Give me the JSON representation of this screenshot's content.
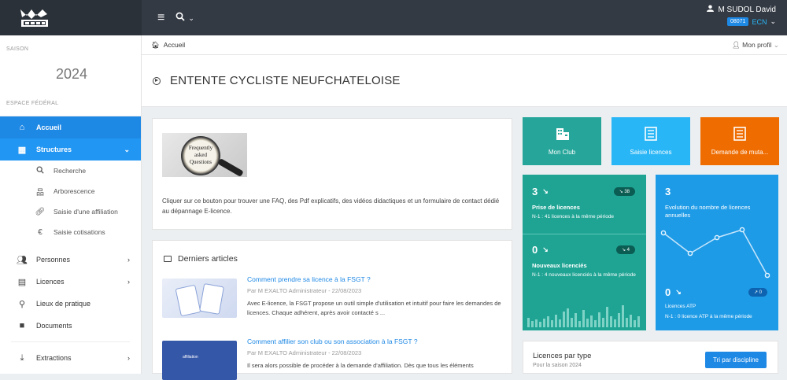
{
  "header": {
    "user_name": "M SUDOL David",
    "user_code": "08071",
    "club_short": "ECN"
  },
  "sidebar": {
    "season_label": "SAISON",
    "season_year": "2024",
    "space_label": "ESPACE FÉDÉRAL",
    "items": [
      {
        "label": "Accueil"
      },
      {
        "label": "Structures"
      },
      {
        "label": "Personnes"
      },
      {
        "label": "Licences"
      },
      {
        "label": "Lieux de pratique"
      },
      {
        "label": "Documents"
      },
      {
        "label": "Extractions"
      }
    ],
    "sub_items": [
      {
        "label": "Recherche"
      },
      {
        "label": "Arborescence"
      },
      {
        "label": "Saisie d'une affiliation"
      },
      {
        "label": "Saisie cotisations"
      }
    ]
  },
  "breadcrumb": {
    "home": "Accueil",
    "profile": "Mon profil"
  },
  "page": {
    "title": "ENTENTE CYCLISTE NEUFCHATELOISE"
  },
  "faq": {
    "image_text_1": "Frequently",
    "image_text_2": "asked",
    "image_text_3": "Questions",
    "text": "Cliquer sur ce bouton pour trouver une FAQ, des Pdf explicatifs, des vidéos didactiques et un formulaire de contact dédié au dépannage E-licence."
  },
  "articles": {
    "heading": "Derniers articles",
    "items": [
      {
        "title": "Comment prendre sa licence à la FSGT ?",
        "meta": "Par M EXALTO Administrateur - 22/08/2023",
        "desc": "Avec E-licence, la FSGT propose un outil simple d'utilisation et intuitif pour faire les demandes de licences. Chaque adhérent, après avoir contacté s ..."
      },
      {
        "title": "Comment affilier son club ou son association à la FSGT ?",
        "meta": "Par M EXALTO Administrateur - 22/08/2023",
        "desc": "Il sera alors possible de procéder à la demande d'affiliation. Dès que tous les éléments",
        "thumb_label": "affiliation"
      }
    ]
  },
  "tiles": [
    {
      "label": "Mon Club"
    },
    {
      "label": "Saisie licences"
    },
    {
      "label": "Demande de muta..."
    }
  ],
  "stats": {
    "prise": {
      "value": "3",
      "pill": "38",
      "label": "Prise de licences",
      "note": "N-1 : 41 licences à la même période"
    },
    "nouveaux": {
      "value": "0",
      "pill": "4",
      "label": "Nouveaux licenciés",
      "note": "N-1 : 4 nouveaux licenciés à la même période"
    },
    "evolution": {
      "value": "3",
      "label": "Evolution du nombre de licences annuelles"
    },
    "atp": {
      "value": "0",
      "pill": "0",
      "label": "Licences ATP",
      "note": "N-1 : 0 licence ATP à la même période"
    }
  },
  "licences_type": {
    "title": "Licences par type",
    "subtitle": "Pour la saison 2024",
    "button": "Tri par discipline"
  }
}
